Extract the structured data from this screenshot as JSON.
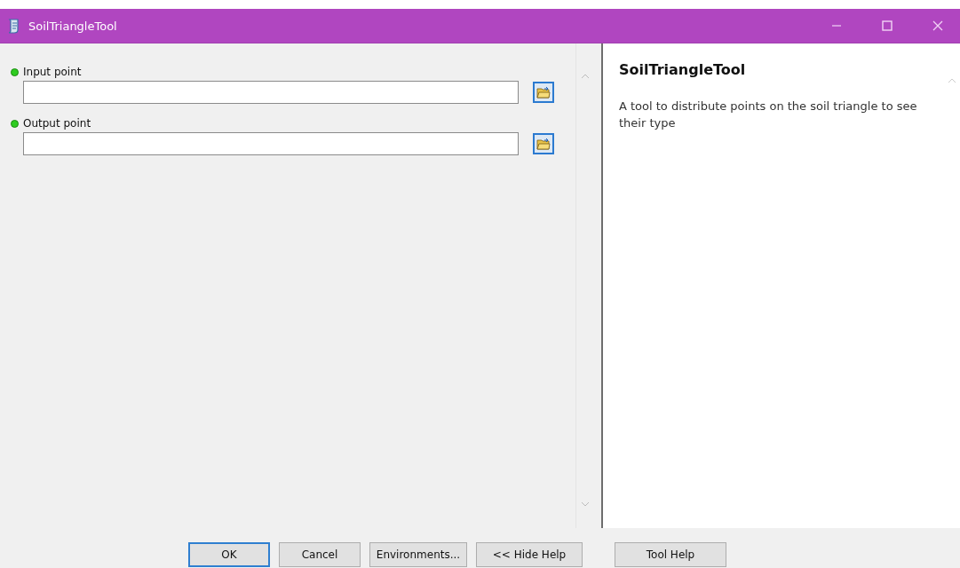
{
  "window": {
    "title": "SoilTriangleTool"
  },
  "parameters": [
    {
      "label": "Input point",
      "required": true
    },
    {
      "label": "Output point",
      "required": true
    }
  ],
  "help": {
    "title": "SoilTriangleTool",
    "text": "A tool to distribute points on the soil triangle to see their type"
  },
  "buttons": [
    {
      "label": "OK",
      "default": true
    },
    {
      "label": "Cancel",
      "default": false
    },
    {
      "label": "Environments...",
      "default": false
    },
    {
      "label": "<< Hide Help",
      "default": false
    },
    {
      "label": "Tool Help",
      "default": false
    }
  ]
}
